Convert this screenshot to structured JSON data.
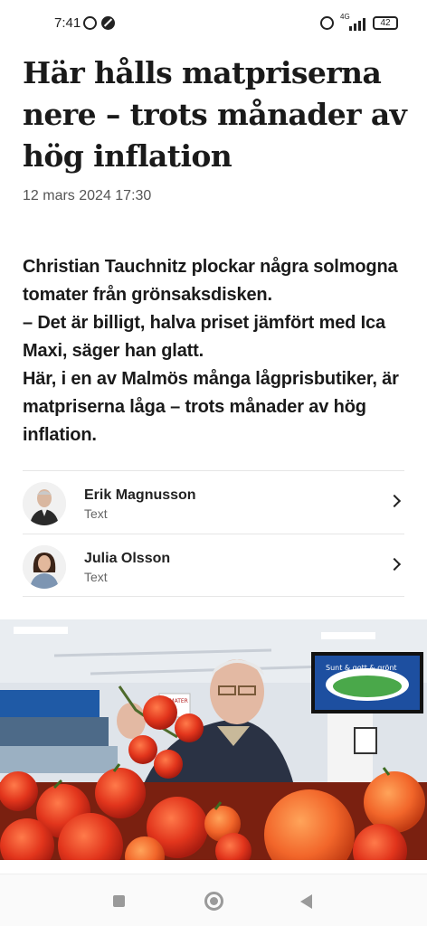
{
  "status_bar": {
    "time": "7:41",
    "network": "4G",
    "battery": "42"
  },
  "article": {
    "headline": "Här hålls matpriserna nere – trots månader av hög inflation",
    "date": "12 mars 2024 17:30",
    "lead": [
      "Christian Tauchnitz plockar några solmogna tomater från grönsaksdisken.",
      "– Det är billigt, halva priset jämfört med Ica Maxi, säger han glatt.",
      "Här, i en av Malmös många lågprisbutiker, är matpriserna låga – trots månader av hög inflation."
    ],
    "authors": [
      {
        "name": "Erik Magnusson",
        "role": "Text"
      },
      {
        "name": "Julia Olsson",
        "role": "Text"
      }
    ],
    "photo": {
      "store_sign": "TOMATER",
      "tv_text": "Sunt & gott & grönt"
    }
  },
  "icons": {
    "whatsapp": "whatsapp-icon",
    "dnd": "do-not-disturb-icon",
    "alarm": "alarm-icon",
    "signal": "signal-icon",
    "battery": "battery-icon",
    "chevron": "chevron-right-icon",
    "nav_recent": "square-icon",
    "nav_home": "circle-icon",
    "nav_back": "back-triangle-icon"
  }
}
